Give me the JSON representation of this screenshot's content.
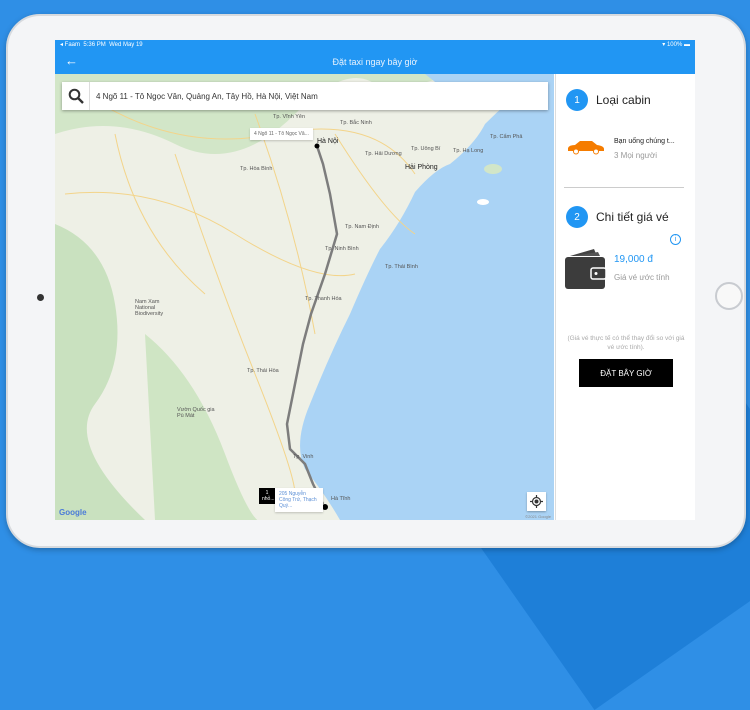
{
  "status_bar": {
    "carrier": "◂ Faam",
    "time": "5:36 PM",
    "date": "Wed May 19",
    "battery": "100%"
  },
  "header": {
    "title": "Đặt taxi ngay bây giờ",
    "back_icon": "arrow-left-icon"
  },
  "search": {
    "value": "4 Ngõ 11 - Tô Ngọc Vân, Quảng An, Tây Hồ, Hà Nội, Việt Nam",
    "icon": "search-icon"
  },
  "map": {
    "origin_tooltip": "4 Ngõ 11 - Tô Ngọc Vâ...",
    "dest_badge": "1 nhỏ...",
    "dest_tooltip": "205 Nguyễn Công Trứ, Thạch Quý...",
    "google": "Google",
    "copyright": "©2021 Google",
    "labels": [
      "Hà Nội",
      "Hải Phòng",
      "Tp. Bắc Ninh",
      "Tp. Hải Dương",
      "Tp. Hạ Long",
      "Tp. Cẩm Phả",
      "Tp. Uông Bí",
      "Tp. Thái Bình",
      "Tp. Nam Định",
      "Tp. Ninh Bình",
      "Tp. Thanh Hóa",
      "Tp. Vinh",
      "Tp. Hòa Bình",
      "Tp. Vĩnh Yên",
      "Nam Xam National Biodiversity",
      "Vườn Quốc gia Pù Mát",
      "Tp. Thái Hòa",
      "Hà Tĩnh"
    ]
  },
  "panel": {
    "step1": {
      "num": "1",
      "title": "Loại cabin",
      "car_name": "Bạn uống chúng t...",
      "car_sub": "3 Mọi người"
    },
    "step2": {
      "num": "2",
      "title": "Chi tiết giá vé",
      "price": "19,000 đ",
      "price_sub": "Giá vé ước tính",
      "info": "i"
    },
    "note": "(Giá vé thực tế có thể thay đổi so với giá vé ước tính).",
    "book_button": "ĐẶT BÂY GIỜ"
  },
  "colors": {
    "accent": "#2196f3",
    "car": "#f57c00",
    "button": "#000000"
  }
}
